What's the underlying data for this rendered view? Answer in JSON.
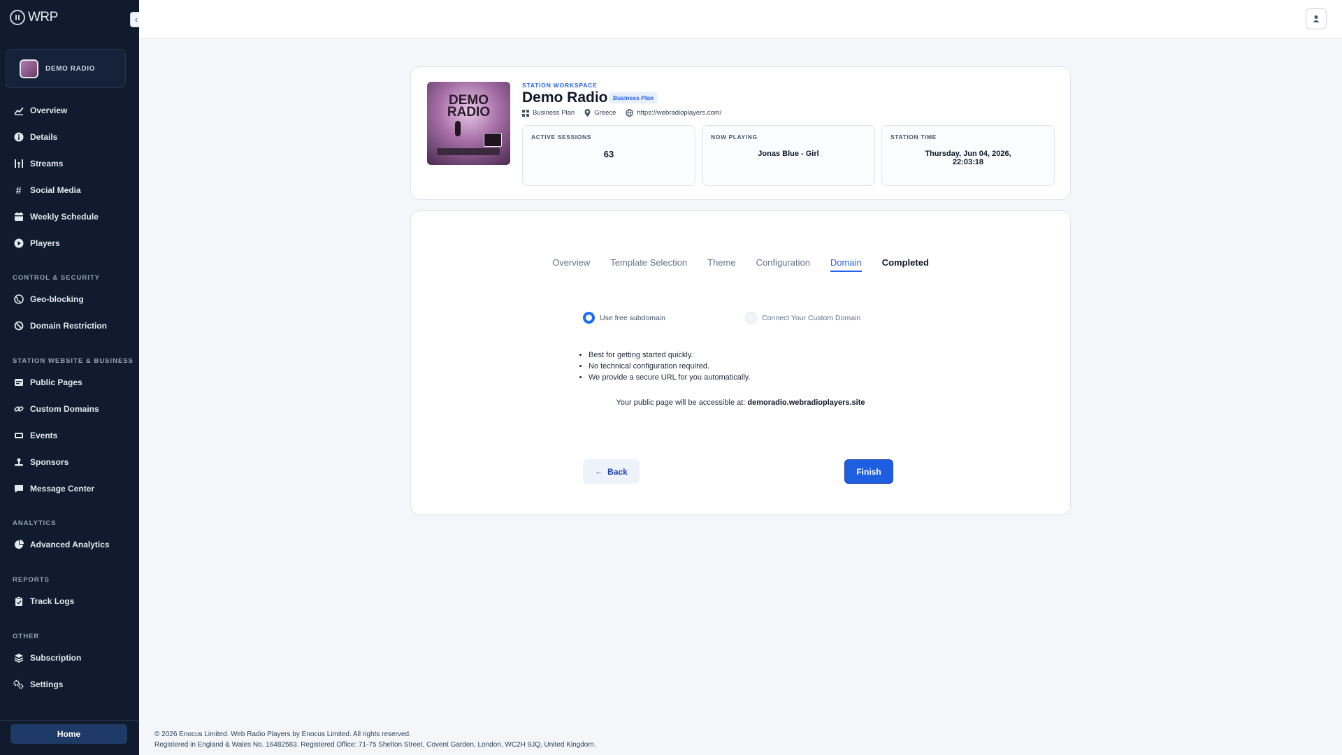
{
  "brand": {
    "name": "WRP"
  },
  "sidebar": {
    "station_name": "DEMO RADIO",
    "main_items": [
      {
        "label": "Overview",
        "icon": "chart-line-icon"
      },
      {
        "label": "Details",
        "icon": "info-icon"
      },
      {
        "label": "Streams",
        "icon": "antenna-icon"
      },
      {
        "label": "Social Media",
        "icon": "hash-icon"
      },
      {
        "label": "Weekly Schedule",
        "icon": "calendar-icon"
      },
      {
        "label": "Players",
        "icon": "play-icon"
      }
    ],
    "sections": {
      "control": "CONTROL & SECURITY",
      "website": "STATION WEBSITE & BUSINESS",
      "analytics": "ANALYTICS",
      "reports": "REPORTS",
      "other": "OTHER"
    },
    "control_items": [
      {
        "label": "Geo-blocking",
        "icon": "globe-icon"
      },
      {
        "label": "Domain Restriction",
        "icon": "ban-icon"
      }
    ],
    "website_items": [
      {
        "label": "Public Pages",
        "icon": "page-icon"
      },
      {
        "label": "Custom Domains",
        "icon": "link-icon"
      },
      {
        "label": "Events",
        "icon": "ticket-icon"
      },
      {
        "label": "Sponsors",
        "icon": "hand-icon"
      },
      {
        "label": "Message Center",
        "icon": "message-icon"
      }
    ],
    "analytics_items": [
      {
        "label": "Advanced Analytics",
        "icon": "pie-chart-icon"
      }
    ],
    "reports_items": [
      {
        "label": "Track Logs",
        "icon": "clipboard-icon"
      }
    ],
    "other_items": [
      {
        "label": "Subscription",
        "icon": "layers-icon"
      },
      {
        "label": "Settings",
        "icon": "gears-icon"
      }
    ],
    "home_label": "Home"
  },
  "station": {
    "workspace_label": "STATION WORKSPACE",
    "title": "Demo Radio",
    "plan_badge": "Business Plan",
    "cover_text": "DEMO RADIO",
    "meta": {
      "plan": "Business Plan",
      "country": "Greece",
      "url": "https://webradioplayers.com/"
    },
    "stats": {
      "sessions_label": "ACTIVE SESSIONS",
      "sessions_value": "63",
      "playing_label": "NOW PLAYING",
      "playing_value": "Jonas Blue - Girl",
      "time_label": "STATION TIME",
      "time_value_line1": "Thursday, Jun 04, 2026,",
      "time_value_line2": "22:03:18"
    }
  },
  "wizard": {
    "tabs": [
      "Overview",
      "Template Selection",
      "Theme",
      "Configuration",
      "Domain",
      "Completed"
    ],
    "active_tab": "Domain",
    "option_free": "Use free subdomain",
    "option_custom": "Connect Your Custom Domain",
    "bullets": [
      "Best for getting started quickly.",
      "No technical configuration required.",
      "We provide a secure URL for you automatically."
    ],
    "public_prefix": "Your public page will be accessible at:",
    "public_url": "demoradio.webradioplayers.site",
    "back_label": "Back",
    "finish_label": "Finish"
  },
  "footer": {
    "line1": "© 2026 Enocus Limited. Web Radio Players by Enocus Limited. All rights reserved.",
    "line2": "Registered in England & Wales No. 16482583. Registered Office: 71-75 Shelton Street, Covent Garden, London, WC2H 9JQ, United Kingdom."
  },
  "colors": {
    "sidebar_bg": "#111b2e",
    "accent": "#2563eb",
    "page_bg": "#f4f6fa"
  }
}
